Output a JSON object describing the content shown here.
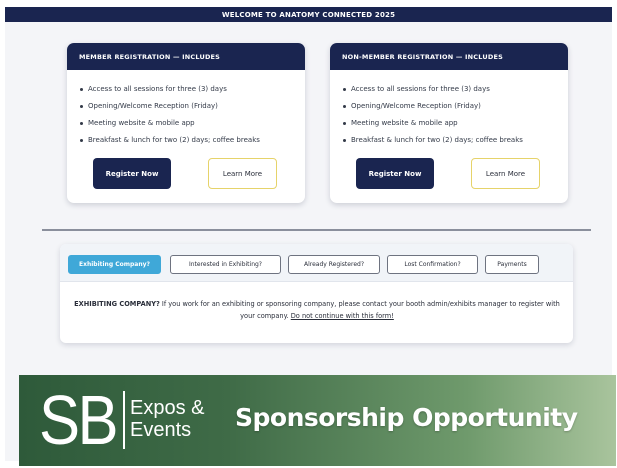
{
  "banner": {
    "title": "WELCOME TO ANATOMY CONNECTED 2025"
  },
  "member_card": {
    "heading": "MEMBER REGISTRATION — INCLUDES",
    "items": [
      "Access to all sessions for three (3) days",
      "Opening/Welcome Reception (Friday)",
      "Meeting website & mobile app",
      "Breakfast & lunch for two (2) days; coffee breaks"
    ],
    "register_label": "Register Now",
    "learn_label": "Learn More"
  },
  "nonmember_card": {
    "heading": "NON-MEMBER REGISTRATION — INCLUDES",
    "items": [
      "Access to all sessions for three (3) days",
      "Opening/Welcome Reception (Friday)",
      "Meeting website & mobile app",
      "Breakfast & lunch for two (2) days; coffee breaks"
    ],
    "register_label": "Register Now",
    "learn_label": "Learn More"
  },
  "tabs": [
    {
      "label": "Exhibiting Company?",
      "active": true
    },
    {
      "label": "Interested in Exhibiting?",
      "active": false
    },
    {
      "label": "Already Registered?",
      "active": false
    },
    {
      "label": "Lost Confirmation?",
      "active": false
    },
    {
      "label": "Payments",
      "active": false
    }
  ],
  "info": {
    "lead": "EXHIBITING COMPANY?",
    "body": " If you work for an exhibiting or sponsoring company, please contact your booth admin/exhibits manager to register with your company. ",
    "warning": "Do not continue with this form!"
  },
  "sponsor": {
    "logo_letters": "SB",
    "logo_line1": "Expos &",
    "logo_line2": "Events",
    "title": "Sponsorship Opportunity"
  },
  "colors": {
    "navy": "#1a2550",
    "active_tab": "#3fa8d8",
    "learn_border": "#e6d36a",
    "sponsor_green": "#3f6b47"
  }
}
